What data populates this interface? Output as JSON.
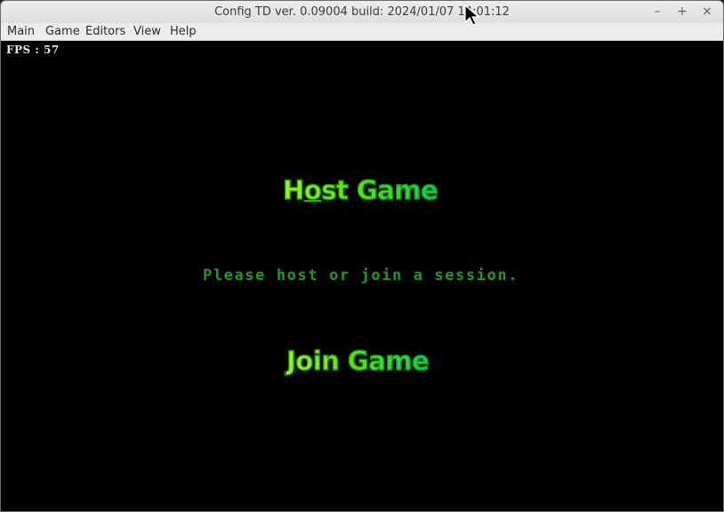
{
  "window": {
    "title": "Config TD ver. 0.09004 build: 2024/01/07  14:01:12",
    "minimize_glyph": "–",
    "maximize_glyph": "+",
    "close_glyph": "×"
  },
  "menubar": {
    "items": [
      {
        "label": "Main"
      },
      {
        "label": "Game"
      },
      {
        "label": "Editors"
      },
      {
        "label": "View"
      },
      {
        "label": "Help"
      }
    ]
  },
  "game": {
    "fps_label": "FPS : 57",
    "host_button": {
      "pre": "H",
      "underlined": "o",
      "post": "st Game"
    },
    "join_button": {
      "pre": "",
      "underlined": "J",
      "post": "oin Game"
    },
    "message": "Please host or join a session."
  },
  "colors": {
    "background": "#000000",
    "button_gradient_start": "#e8ff30",
    "button_gradient_end": "#00d070",
    "message": "#1f9a1f",
    "fps": "#e8e8e8"
  },
  "icons": {
    "cursor": "mouse-pointer-icon"
  }
}
